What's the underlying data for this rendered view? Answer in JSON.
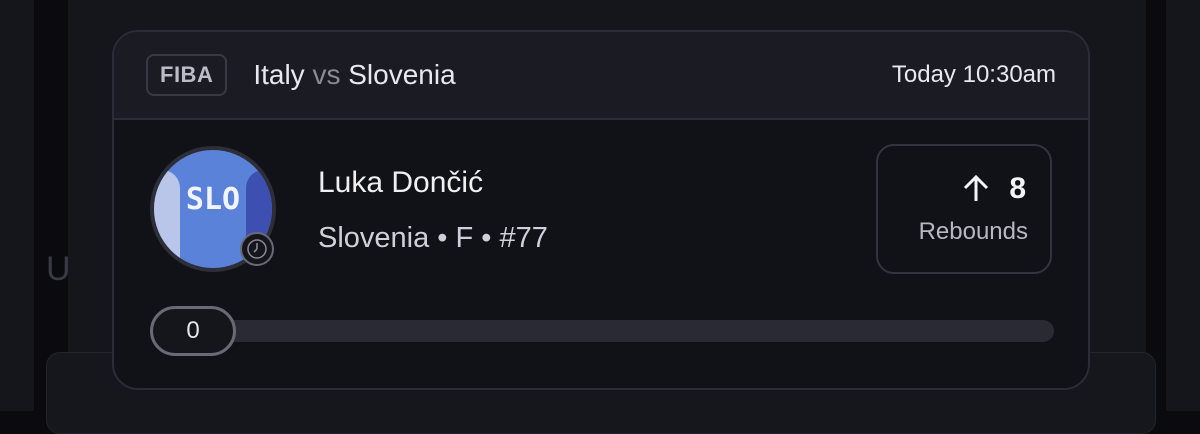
{
  "header": {
    "league": "FIBA",
    "team_home": "Italy",
    "vs": "vs",
    "team_away": "Slovenia",
    "time": "Today 10:30am"
  },
  "player": {
    "name": "Luka Dončić",
    "meta": "Slovenia • F • #77",
    "jersey_text": "SLO",
    "avatar_icon": "jersey-avatar-icon",
    "status_icon": "clock-icon"
  },
  "stat": {
    "icon": "arrow-up-icon",
    "value": "8",
    "label": "Rebounds"
  },
  "progress": {
    "value_label": "0",
    "fraction": 0
  },
  "colors": {
    "card_bg": "#111118",
    "header_bg": "#1b1b23",
    "avatar_blue": "#5b82d9",
    "accent_text": "#f0f0f4"
  }
}
